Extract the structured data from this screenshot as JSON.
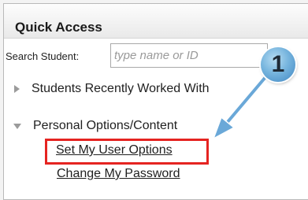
{
  "panel": {
    "title": "Quick Access"
  },
  "search": {
    "label": "Search Student:",
    "placeholder": "type name or ID",
    "value": ""
  },
  "sections": {
    "recent": {
      "label": "Students Recently Worked With",
      "expanded": false,
      "icon": "triangle-right-icon"
    },
    "personal": {
      "label": "Personal Options/Content",
      "expanded": true,
      "icon": "triangle-down-icon",
      "links": [
        {
          "label": "Set My User Options",
          "highlighted": true
        },
        {
          "label": "Change My Password",
          "highlighted": false
        }
      ]
    }
  },
  "annotation": {
    "callout_number": "1",
    "highlight_color": "#e52421",
    "callout_color": "#5aa0d4"
  }
}
